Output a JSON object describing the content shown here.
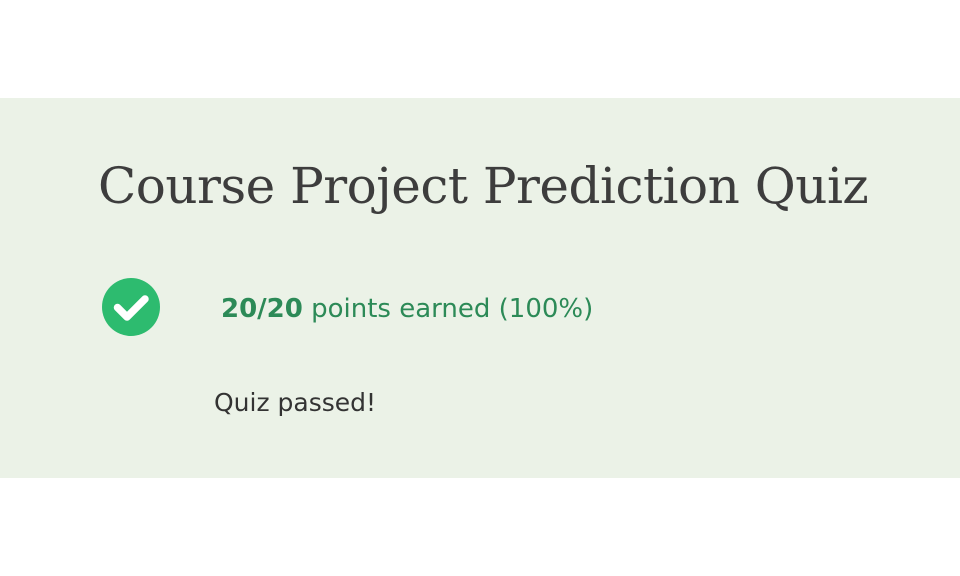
{
  "quiz": {
    "title": "Course Project Prediction Quiz"
  },
  "result": {
    "score": "20/20",
    "points_text": "points earned (100%)",
    "status": "Quiz passed!",
    "icon": "check-circle-icon",
    "colors": {
      "panel_background": "#ebf2e7",
      "success": "#2dbb6f",
      "score_text": "#2c8a57"
    }
  }
}
